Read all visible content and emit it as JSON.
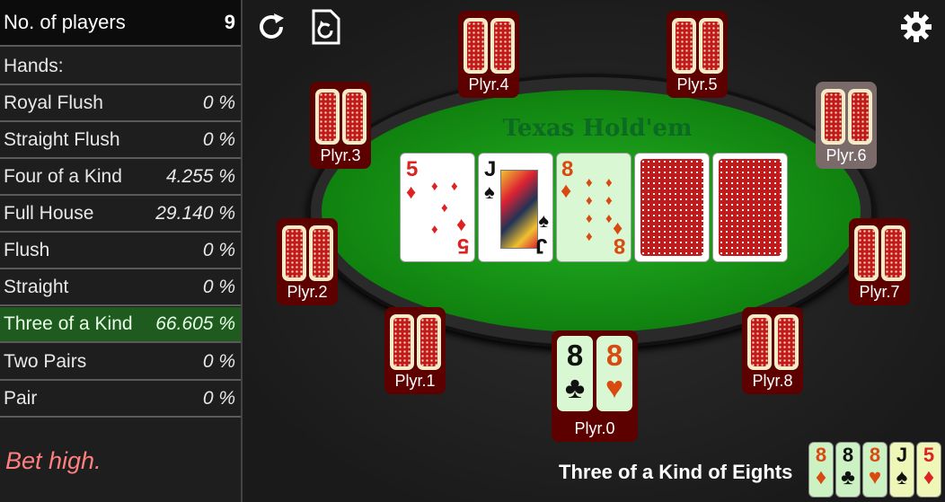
{
  "panel": {
    "players_label": "No. of players",
    "players_count": "9",
    "hands_header": "Hands:",
    "hands": [
      {
        "name": "Royal Flush",
        "pct": "0 %"
      },
      {
        "name": "Straight Flush",
        "pct": "0 %"
      },
      {
        "name": "Four of a Kind",
        "pct": "4.255 %"
      },
      {
        "name": "Full House",
        "pct": "29.140 %"
      },
      {
        "name": "Flush",
        "pct": "0 %"
      },
      {
        "name": "Straight",
        "pct": "0 %"
      },
      {
        "name": "Three of a Kind",
        "pct": "66.605 %"
      },
      {
        "name": "Two Pairs",
        "pct": "0 %"
      },
      {
        "name": "Pair",
        "pct": "0 %"
      }
    ],
    "advice": "Bet high."
  },
  "table": {
    "title": "Texas Hold'em",
    "community": [
      {
        "rank": "5",
        "suit": "♦",
        "color": "#dd2222"
      },
      {
        "rank": "J",
        "suit": "♠",
        "color": "#111111"
      },
      {
        "rank": "8",
        "suit": "♦",
        "color": "#d84a10"
      }
    ]
  },
  "players": {
    "p0": {
      "name": "Plyr.0",
      "cards": [
        {
          "rank": "8",
          "suit": "♣"
        },
        {
          "rank": "8",
          "suit": "♥"
        }
      ]
    },
    "p1": "Plyr.1",
    "p2": "Plyr.2",
    "p3": "Plyr.3",
    "p4": "Plyr.4",
    "p5": "Plyr.5",
    "p6": "Plyr.6",
    "p7": "Plyr.7",
    "p8": "Plyr.8"
  },
  "best_hand": {
    "label": "Three of a Kind of Eights",
    "cards": [
      {
        "rank": "8",
        "suit": "♦"
      },
      {
        "rank": "8",
        "suit": "♣"
      },
      {
        "rank": "8",
        "suit": "♥"
      },
      {
        "rank": "J",
        "suit": "♠"
      },
      {
        "rank": "5",
        "suit": "♦"
      }
    ]
  },
  "icons": {
    "refresh": "refresh-icon",
    "history": "history-icon",
    "settings": "gear-icon"
  }
}
